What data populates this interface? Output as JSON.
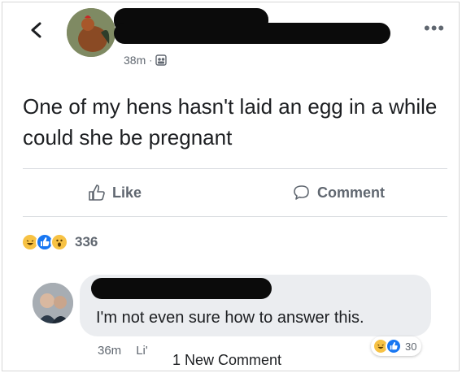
{
  "post": {
    "time": "38m",
    "separator": "·",
    "privacy_icon": "friends-group-icon",
    "text": "One of my hens hasn't laid an egg in a while could she be pregnant",
    "more_glyph": "•••"
  },
  "actions": {
    "like_label": "Like",
    "comment_label": "Comment"
  },
  "reactions": {
    "types": [
      "haha-icon",
      "like-icon",
      "wow-icon"
    ],
    "count": "336"
  },
  "comment": {
    "text": "I'm not even sure how to answer this.",
    "time": "36m",
    "like_label": "Li'",
    "reaction_count": "30",
    "new_comment_label": "1 New Comment"
  },
  "colors": {
    "text": "#1c1e21",
    "meta": "#606770",
    "bubble": "#ebedf0",
    "like_blue": "#1877f2",
    "emoji_yellow": "#f7c244"
  }
}
